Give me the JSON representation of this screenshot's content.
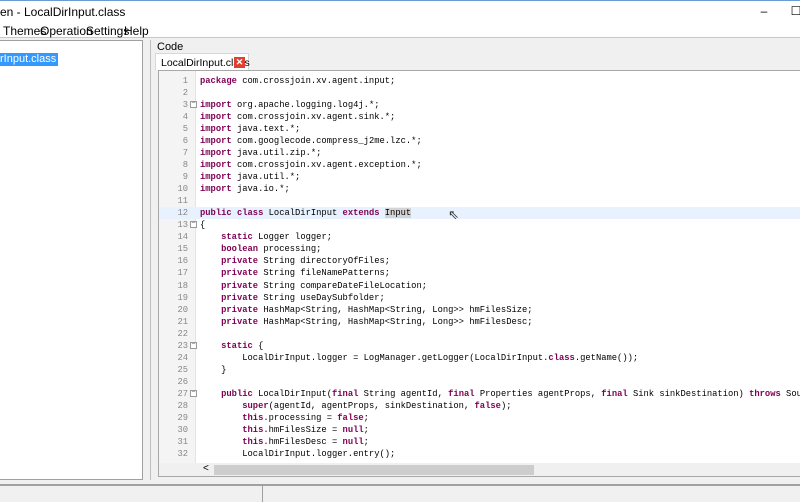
{
  "window": {
    "title": "en - LocalDirInput.class",
    "minimize": "–",
    "maximize": "☐"
  },
  "menu": [
    "Themes",
    "Operation",
    "Settings",
    "Help"
  ],
  "tree": {
    "selected": "rInput.class"
  },
  "code_panel": {
    "label": "Code",
    "tab": "LocalDirInput.class",
    "close": "✕"
  },
  "scroll": {
    "left_arrow": "<"
  },
  "editor": {
    "highlighted_line": 12,
    "fold_lines": [
      3,
      13,
      23,
      27
    ],
    "lines": [
      [
        [
          "package",
          "kw"
        ],
        [
          " com.crossjoin.xv.agent.input;",
          ""
        ]
      ],
      [],
      [
        [
          "import",
          "kw"
        ],
        [
          " org.apache.logging.log4j.*;",
          ""
        ]
      ],
      [
        [
          "import",
          "kw"
        ],
        [
          " com.crossjoin.xv.agent.sink.*;",
          ""
        ]
      ],
      [
        [
          "import",
          "kw"
        ],
        [
          " java.text.*;",
          ""
        ]
      ],
      [
        [
          "import",
          "kw"
        ],
        [
          " com.googlecode.compress_j2me.lzc.*;",
          ""
        ]
      ],
      [
        [
          "import",
          "kw"
        ],
        [
          " java.util.zip.*;",
          ""
        ]
      ],
      [
        [
          "import",
          "kw"
        ],
        [
          " com.crossjoin.xv.agent.exception.*;",
          ""
        ]
      ],
      [
        [
          "import",
          "kw"
        ],
        [
          " java.util.*;",
          ""
        ]
      ],
      [
        [
          "import",
          "kw"
        ],
        [
          " java.io.*;",
          ""
        ]
      ],
      [],
      [
        [
          "public class",
          "kw"
        ],
        [
          " LocalDirInput ",
          ""
        ],
        [
          "extends",
          "kw"
        ],
        [
          " ",
          ""
        ],
        [
          "Input",
          "mark"
        ]
      ],
      [
        [
          "{",
          ""
        ]
      ],
      [
        [
          "    ",
          ""
        ],
        [
          "static",
          "kw"
        ],
        [
          " Logger logger;",
          ""
        ]
      ],
      [
        [
          "    ",
          ""
        ],
        [
          "boolean",
          "kw"
        ],
        [
          " processing;",
          ""
        ]
      ],
      [
        [
          "    ",
          ""
        ],
        [
          "private",
          "kw"
        ],
        [
          " String directoryOfFiles;",
          ""
        ]
      ],
      [
        [
          "    ",
          ""
        ],
        [
          "private",
          "kw"
        ],
        [
          " String fileNamePatterns;",
          ""
        ]
      ],
      [
        [
          "    ",
          ""
        ],
        [
          "private",
          "kw"
        ],
        [
          " String compareDateFileLocation;",
          ""
        ]
      ],
      [
        [
          "    ",
          ""
        ],
        [
          "private",
          "kw"
        ],
        [
          " String useDaySubfolder;",
          ""
        ]
      ],
      [
        [
          "    ",
          ""
        ],
        [
          "private",
          "kw"
        ],
        [
          " HashMap<String, HashMap<String, Long>> hmFilesSize;",
          ""
        ]
      ],
      [
        [
          "    ",
          ""
        ],
        [
          "private",
          "kw"
        ],
        [
          " HashMap<String, HashMap<String, Long>> hmFilesDesc;",
          ""
        ]
      ],
      [],
      [
        [
          "    ",
          ""
        ],
        [
          "static",
          "kw"
        ],
        [
          " {",
          ""
        ]
      ],
      [
        [
          "        LocalDirInput.logger = LogManager.getLogger(LocalDirInput.",
          ""
        ],
        [
          "class",
          "kw"
        ],
        [
          ".getName());",
          ""
        ]
      ],
      [
        [
          "    }",
          ""
        ]
      ],
      [],
      [
        [
          "    ",
          ""
        ],
        [
          "public",
          "kw"
        ],
        [
          " LocalDirInput(",
          ""
        ],
        [
          "final",
          "kw"
        ],
        [
          " String agentId, ",
          ""
        ],
        [
          "final",
          "kw"
        ],
        [
          " Properties agentProps, ",
          ""
        ],
        [
          "final",
          "kw"
        ],
        [
          " Sink sinkDestination) ",
          ""
        ],
        [
          "throws",
          "kw"
        ],
        [
          " Sou",
          ""
        ]
      ],
      [
        [
          "        ",
          ""
        ],
        [
          "super",
          "kw"
        ],
        [
          "(agentId, agentProps, sinkDestination, ",
          ""
        ],
        [
          "false",
          "kw"
        ],
        [
          ");",
          ""
        ]
      ],
      [
        [
          "        ",
          ""
        ],
        [
          "this",
          "kw"
        ],
        [
          ".processing = ",
          ""
        ],
        [
          "false",
          "kw"
        ],
        [
          ";",
          ""
        ]
      ],
      [
        [
          "        ",
          ""
        ],
        [
          "this",
          "kw"
        ],
        [
          ".hmFilesSize = ",
          ""
        ],
        [
          "null",
          "kw"
        ],
        [
          ";",
          ""
        ]
      ],
      [
        [
          "        ",
          ""
        ],
        [
          "this",
          "kw"
        ],
        [
          ".hmFilesDesc = ",
          ""
        ],
        [
          "null",
          "kw"
        ],
        [
          ";",
          ""
        ]
      ],
      [
        [
          "        LocalDirInput.logger.entry();",
          ""
        ]
      ]
    ]
  }
}
